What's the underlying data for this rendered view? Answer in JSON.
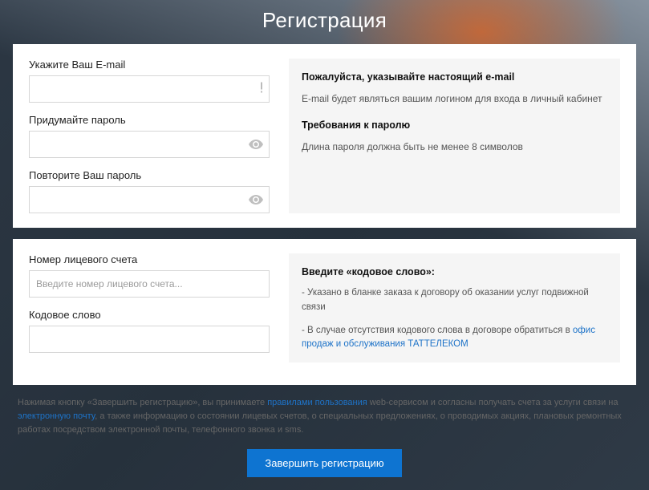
{
  "title": "Регистрация",
  "section1": {
    "email_label": "Укажите Ваш E-mail",
    "password_label": "Придумайте пароль",
    "confirm_label": "Повторите Ваш пароль",
    "info_email_title": "Пожалуйста, указывайте настоящий e-mail",
    "info_email_text": "E-mail будет являться вашим логином для входа в личный кабинет",
    "info_pwd_title": "Требования к паролю",
    "info_pwd_text": "Длина пароля должна быть не менее 8 символов"
  },
  "section2": {
    "account_label": "Номер лицевого счета",
    "account_placeholder": "Введите номер лицевого счета...",
    "codeword_label": "Кодовое слово",
    "info_title": "Введите «кодовое слово»:",
    "info_line1": "- Указано в бланке заказа к договору об оказании услуг подвижной связи",
    "info_line2_a": "- В случае отсутствия кодового слова в договоре обратиться в ",
    "info_line2_link": "офис продаж и обслуживания ТАТТЕЛЕКОМ"
  },
  "legal": {
    "part1": "Нажимая кнопку «Завершить регистрацию», вы принимаете ",
    "link1": "правилами пользования",
    "part2": " web-сервисом и согласны получать счета за услуги связи на ",
    "link2": "электронную почту",
    "part3": ", а также информацию о состоянии лицевых счетов, о специальных предложениях, о проводимых акциях, плановых ремонтных работах посредством электронной почты, телефонного звонка и sms."
  },
  "submit_label": "Завершить регистрацию"
}
